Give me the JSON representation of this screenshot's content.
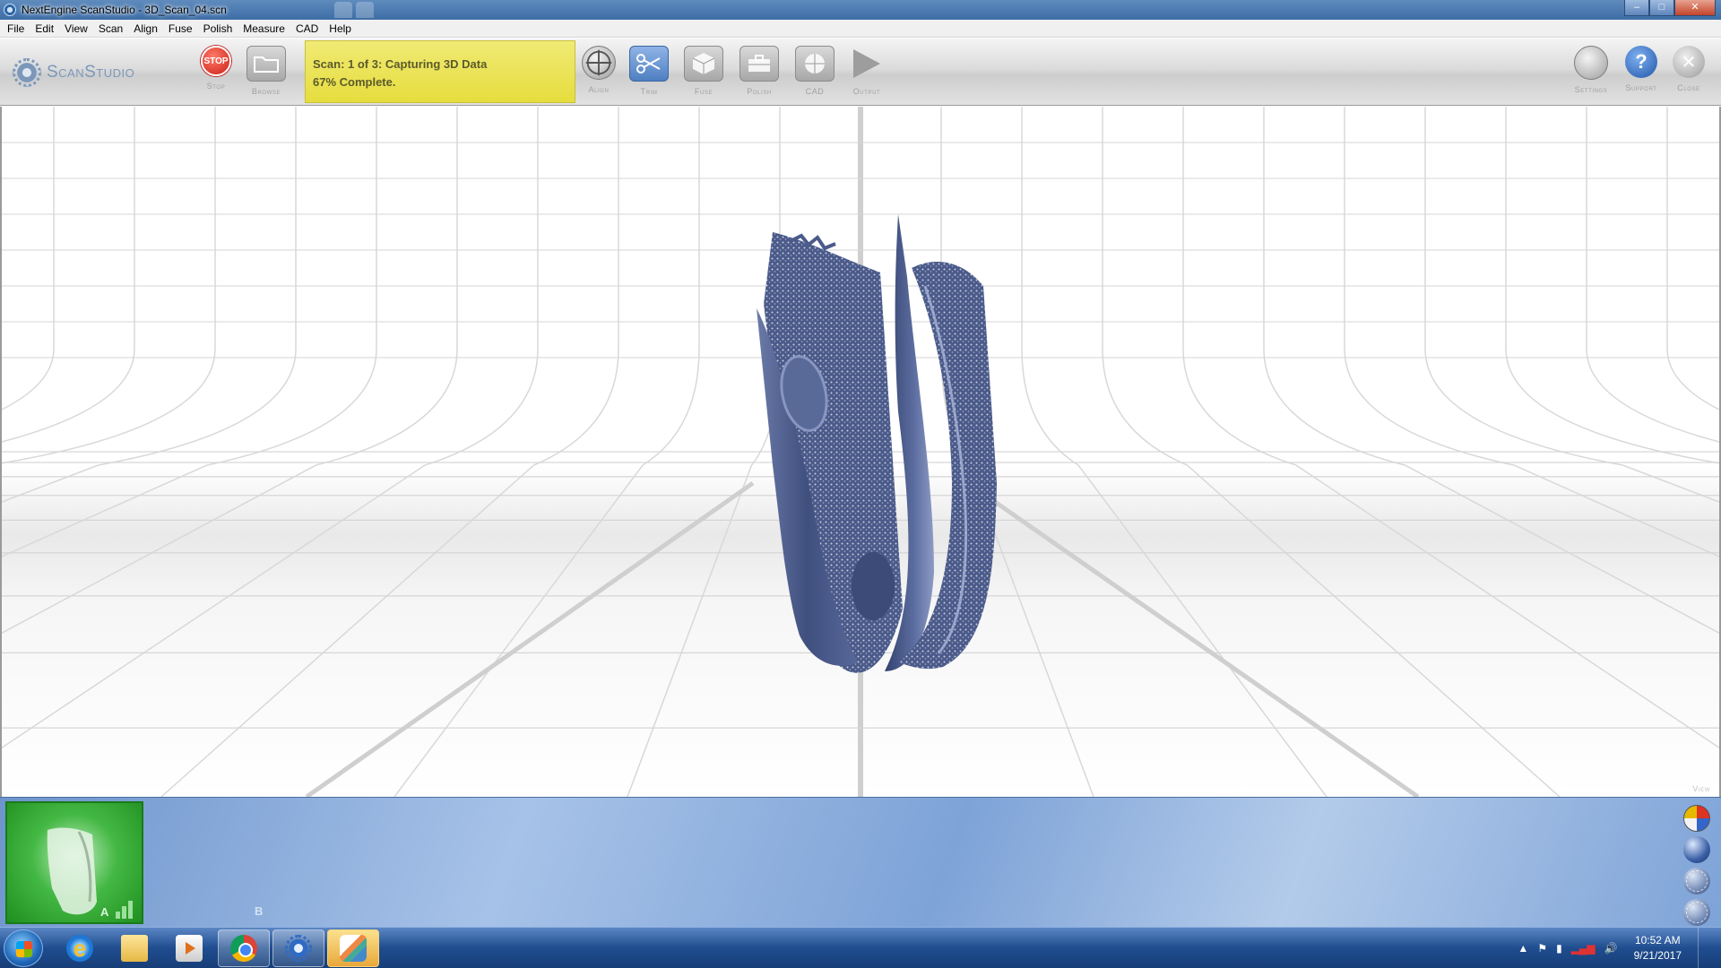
{
  "window": {
    "title": "NextEngine ScanStudio - 3D_Scan_04.scn",
    "background_tabs": [
      "",
      ""
    ],
    "controls": {
      "minimize": "–",
      "maximize": "□",
      "close": "✕"
    }
  },
  "menubar": [
    "File",
    "Edit",
    "View",
    "Scan",
    "Align",
    "Fuse",
    "Polish",
    "Measure",
    "CAD",
    "Help"
  ],
  "toolbar": {
    "logo": "ScanStudio",
    "stop": {
      "icon_text": "STOP",
      "label": "Stop",
      "icon": "stop-icon"
    },
    "browse": {
      "label": "Browse",
      "icon": "folder-icon"
    },
    "status": {
      "line1": "Scan: 1 of 3: Capturing 3D Data",
      "line2": "67% Complete.",
      "progress_percent": 67,
      "color": "#e9e04a"
    },
    "align": {
      "label": "Align",
      "icon": "crosshair-icon"
    },
    "trim": {
      "label": "Trim",
      "icon": "scissors-icon"
    },
    "fuse": {
      "label": "Fuse",
      "icon": "cube-icon"
    },
    "polish": {
      "label": "Polish",
      "icon": "toolbox-icon"
    },
    "cad": {
      "label": "CAD",
      "icon": "globe-icon"
    },
    "output": {
      "label": "Output",
      "icon": "play-icon"
    },
    "settings": {
      "label": "Settings",
      "icon": "gear-icon"
    },
    "support": {
      "label": "Support",
      "icon_text": "?",
      "icon": "help-icon"
    },
    "close": {
      "label": "Close",
      "icon_text": "✕",
      "icon": "close-icon"
    }
  },
  "viewport": {
    "view_label": "View",
    "model_color": "#4a5a86"
  },
  "thumbstrip": {
    "slot_a_label": "A",
    "slot_b_label": "B",
    "view_orbs": [
      "color-sphere-icon",
      "solid-sphere-icon",
      "wireframe-sphere-icon",
      "points-sphere-icon"
    ]
  },
  "taskbar": {
    "apps": [
      "start-button",
      "internet-explorer-icon",
      "file-explorer-icon",
      "media-player-icon",
      "chrome-icon",
      "scanstudio-icon",
      "paint-icon"
    ],
    "tray": {
      "up_arrow": "▲",
      "flag": "⚑",
      "battery": "▮",
      "signal": "▂▄▆",
      "volume": "🔊"
    },
    "time": "10:52 AM",
    "date": "9/21/2017"
  }
}
